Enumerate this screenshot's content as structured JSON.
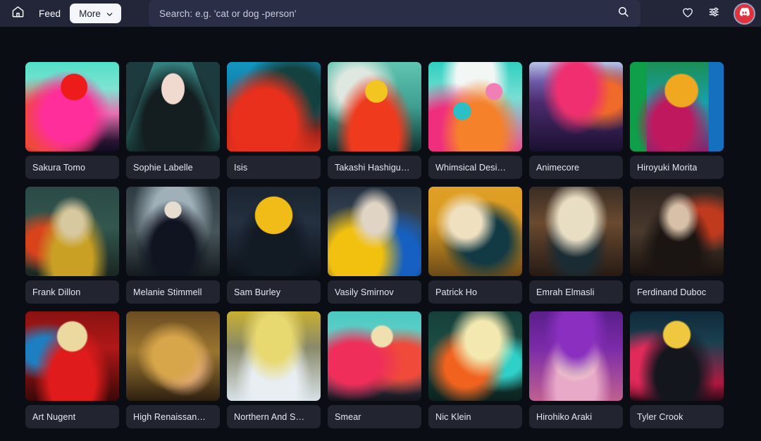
{
  "header": {
    "home_icon": "home-icon",
    "feed_label": "Feed",
    "more_label": "More",
    "more_chevron_icon": "chevron-down-icon",
    "search": {
      "placeholder": "Search: e.g. 'cat or dog -person'",
      "value": "",
      "submit_icon": "search-icon"
    },
    "favorites_icon": "heart-icon",
    "filters_icon": "sliders-icon",
    "avatar_icon": "discord-avatar",
    "avatar_color": "#e0323c",
    "background_color": "#232539",
    "search_background_color": "#2b2e47"
  },
  "feed": {
    "background_color": "#0b0d14",
    "card_label_color": "#22252f",
    "cards": [
      {
        "title": "Sakura Tomo",
        "art": "a0"
      },
      {
        "title": "Sophie Labelle",
        "art": "a1"
      },
      {
        "title": "Isis",
        "art": "a2"
      },
      {
        "title": "Takashi Hashigu…",
        "art": "a3"
      },
      {
        "title": "Whimsical Desi…",
        "art": "a4"
      },
      {
        "title": "Animecore",
        "art": "a5"
      },
      {
        "title": "Hiroyuki Morita",
        "art": "a6"
      },
      {
        "title": "Frank Dillon",
        "art": "b0"
      },
      {
        "title": "Melanie Stimmell",
        "art": "b1"
      },
      {
        "title": "Sam Burley",
        "art": "b2"
      },
      {
        "title": "Vasily Smirnov",
        "art": "b3"
      },
      {
        "title": "Patrick Ho",
        "art": "b4"
      },
      {
        "title": "Emrah Elmasli",
        "art": "b5"
      },
      {
        "title": "Ferdinand Duboc",
        "art": "b6"
      },
      {
        "title": "Art Nugent",
        "art": "c0"
      },
      {
        "title": "High Renaissan…",
        "art": "c1"
      },
      {
        "title": "Northern And S…",
        "art": "c2"
      },
      {
        "title": "Smear",
        "art": "c3"
      },
      {
        "title": "Nic Klein",
        "art": "c4"
      },
      {
        "title": "Hirohiko Araki",
        "art": "c5"
      },
      {
        "title": "Tyler Crook",
        "art": "c6"
      }
    ]
  }
}
